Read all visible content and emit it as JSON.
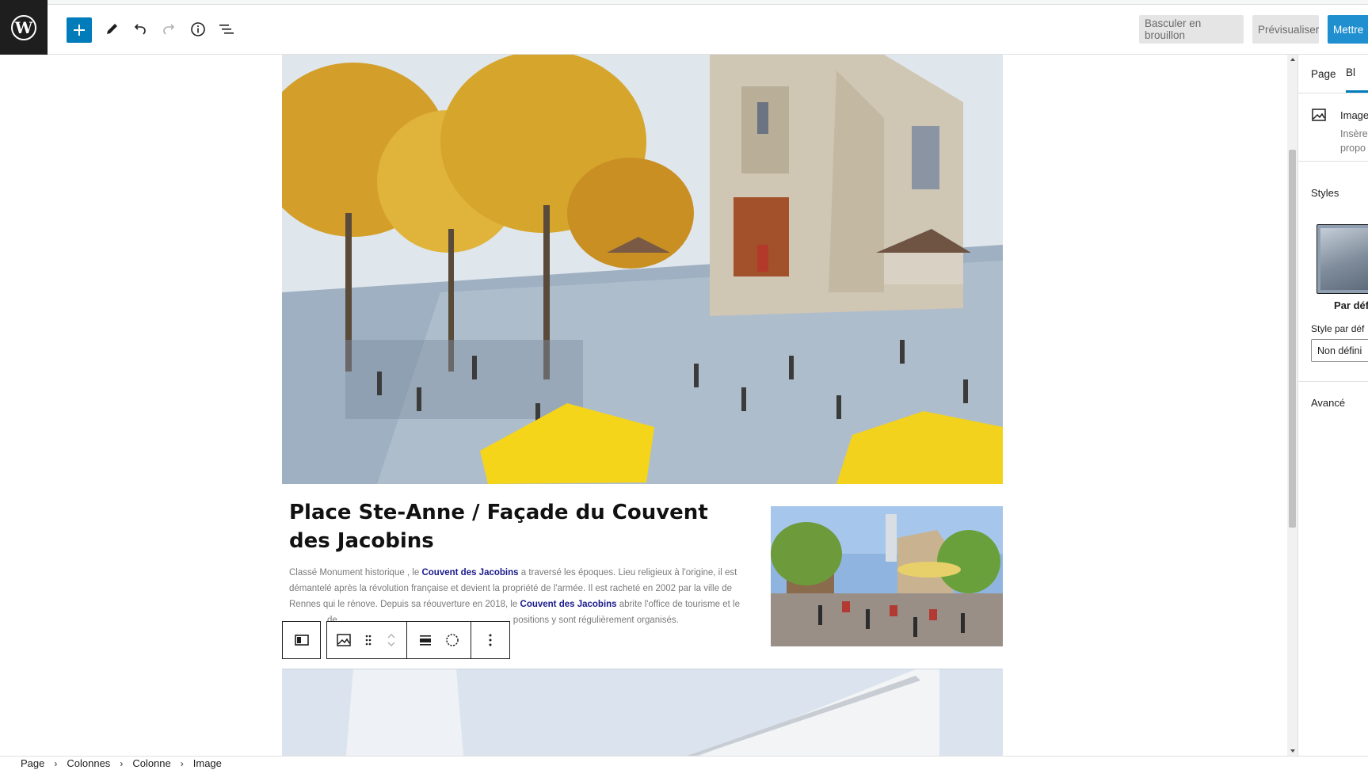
{
  "toolbar": {
    "draft_label": "Basculer en brouillon",
    "preview_label": "Prévisualiser",
    "update_label": "Mettre"
  },
  "content": {
    "heading": "Place Ste-Anne / Façade du Couvent des Jacobins",
    "paragraph_parts": [
      "Classé Monument historique , le ",
      "Couvent des Jacobins",
      " a traversé les époques. Lieu religieux à l'origine, il est démantelé après la révolution française et devient la propriété de l'armée. Il est racheté en 2002 par la ville de Rennes qui le rénove. Depuis sa réouverture en 2018, le ",
      "Couvent des Jacobins",
      " abrite l'office de tourisme et le",
      " de",
      "positions y sont régulièrement organisés."
    ]
  },
  "sidebar": {
    "tab_page": "Page",
    "tab_block": "Bl",
    "block_title": "Image",
    "block_desc_1": "Insère",
    "block_desc_2": "propo",
    "styles_label": "Styles",
    "style_default_caption": "Par déf",
    "default_style_label": "Style par déf",
    "default_style_value": "Non défini",
    "advanced_label": "Avancé"
  },
  "breadcrumb": [
    "Page",
    "Colonnes",
    "Colonne",
    "Image"
  ],
  "colors": {
    "accent": "#007cba",
    "update_button": "#1f8fcf",
    "link": "#1a1a8c"
  }
}
